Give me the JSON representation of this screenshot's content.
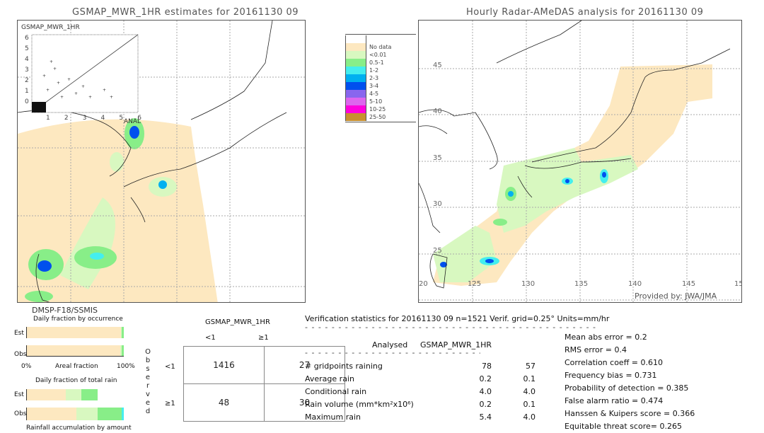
{
  "left_panel": {
    "title": "GSMAP_MWR_1HR estimates for 20161130 09",
    "scatter_label": "GSMAP_MWR_1HR",
    "scatter_y_ticks": [
      "6",
      "5",
      "4",
      "3",
      "2",
      "1",
      "0"
    ],
    "scatter_x_ticks": [
      "1",
      "2",
      "3",
      "4",
      "5",
      "6"
    ],
    "scatter_x_label": "ANAL",
    "satellite": "DMSP-F18/SSMIS"
  },
  "right_panel": {
    "title": "Hourly Radar-AMeDAS analysis for 20161130 09",
    "lat_ticks": [
      "45",
      "40",
      "35",
      "30",
      "25"
    ],
    "lon_ticks": [
      "20",
      "125",
      "130",
      "135",
      "140",
      "145",
      "15"
    ],
    "credit": "Provided by: JWA/JMA"
  },
  "legend": {
    "items": [
      {
        "label": "",
        "color": "#ffffff"
      },
      {
        "label": "No data",
        "color": "#fde8c0"
      },
      {
        "label": "<0.01",
        "color": "#d8f8c0"
      },
      {
        "label": "0.5-1",
        "color": "#88ee88"
      },
      {
        "label": "1-2",
        "color": "#44eeee"
      },
      {
        "label": "2-3",
        "color": "#00b0f0"
      },
      {
        "label": "3-4",
        "color": "#0050ee"
      },
      {
        "label": "4-5",
        "color": "#8866ee"
      },
      {
        "label": "5-10",
        "color": "#dd66ee"
      },
      {
        "label": "10-25",
        "color": "#ff00dd"
      },
      {
        "label": "25-50",
        "color": "#c89030"
      }
    ]
  },
  "fraction_charts": {
    "occurrence_title": "Daily fraction by occurrence",
    "est_label": "Est",
    "obs_label": "Obs",
    "axis_left": "0%",
    "axis_mid": "Areal fraction",
    "axis_right": "100%",
    "total_rain_title": "Daily fraction of total rain",
    "accumulation_title": "Rainfall accumulation by amount",
    "occurrence_est": [
      {
        "color": "#fde8c0",
        "fraction": 0.97
      },
      {
        "color": "#d8f8c0",
        "fraction": 0.01
      },
      {
        "color": "#88ee88",
        "fraction": 0.02
      }
    ],
    "occurrence_obs": [
      {
        "color": "#fde8c0",
        "fraction": 0.96
      },
      {
        "color": "#d8f8c0",
        "fraction": 0.02
      },
      {
        "color": "#88ee88",
        "fraction": 0.02
      }
    ],
    "total_est": [
      {
        "color": "#fde8c0",
        "fraction": 0.4
      },
      {
        "color": "#d8f8c0",
        "fraction": 0.16
      },
      {
        "color": "#88ee88",
        "fraction": 0.17
      }
    ],
    "total_obs": [
      {
        "color": "#fde8c0",
        "fraction": 0.51
      },
      {
        "color": "#d8f8c0",
        "fraction": 0.22
      },
      {
        "color": "#88ee88",
        "fraction": 0.25
      },
      {
        "color": "#44eeee",
        "fraction": 0.02
      }
    ]
  },
  "contingency": {
    "header": "GSMAP_MWR_1HR",
    "col_labels": [
      "<1",
      "≥1"
    ],
    "row_labels": [
      "<1",
      "≥1"
    ],
    "side_label": [
      "O",
      "b",
      "s",
      "e",
      "r",
      "v",
      "e",
      "d"
    ],
    "cells": [
      [
        "1416",
        "27"
      ],
      [
        "48",
        "30"
      ]
    ]
  },
  "verification": {
    "header": "Verification statistics for 20161130 09   n=1521   Verif. grid=0.25°   Units=mm/hr",
    "col_analysed": "Analysed",
    "col_estimate": "GSMAP_MWR_1HR",
    "rows": [
      {
        "label": "# gridpoints raining",
        "analysed": "78",
        "estimate": "57"
      },
      {
        "label": "Average rain",
        "analysed": "0.2",
        "estimate": "0.1"
      },
      {
        "label": "Conditional rain",
        "analysed": "4.0",
        "estimate": "4.0"
      },
      {
        "label": "Rain volume (mm*km²x10⁶)",
        "analysed": "0.2",
        "estimate": "0.1"
      },
      {
        "label": "Maximum rain",
        "analysed": "5.4",
        "estimate": "4.0"
      }
    ],
    "scores": [
      "Mean abs error = 0.2",
      "RMS error = 0.4",
      "Correlation coeff = 0.610",
      "Frequency bias = 0.731",
      "Probability of detection = 0.385",
      "False alarm ratio = 0.474",
      "Hanssen & Kuipers score = 0.366",
      "Equitable threat score= 0.265"
    ]
  }
}
